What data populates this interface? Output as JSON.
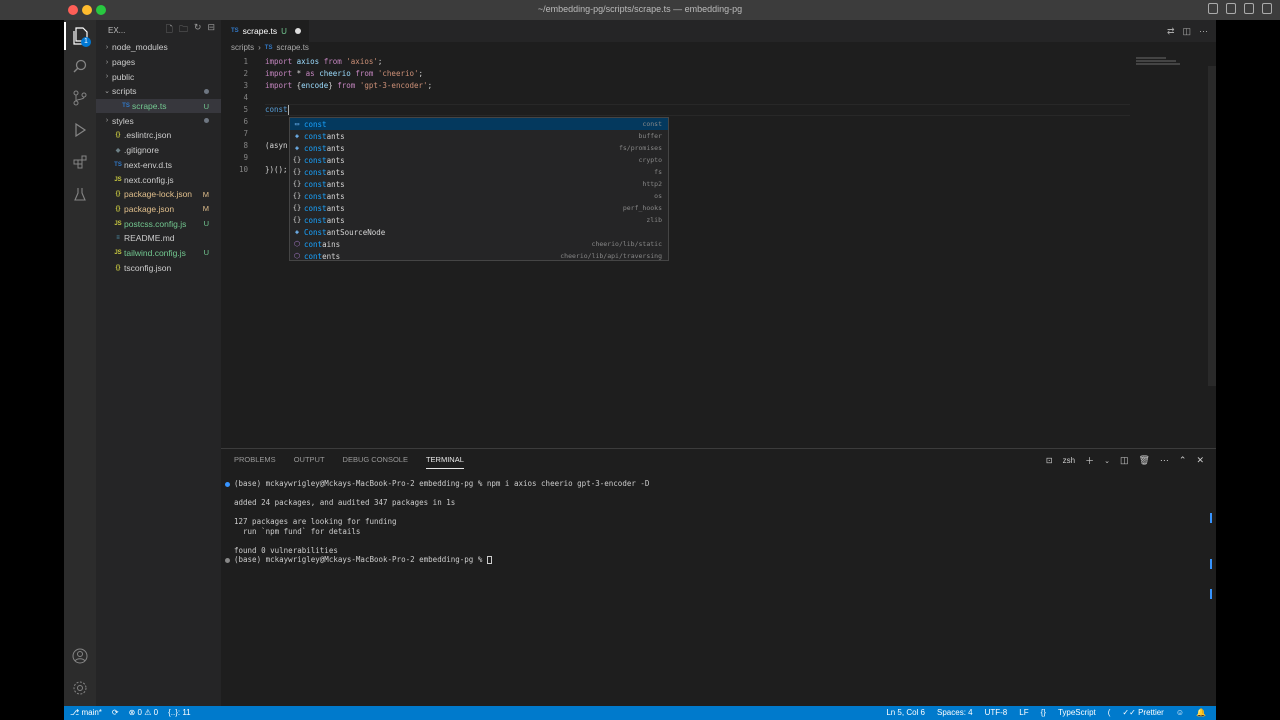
{
  "window": {
    "title": "~/embedding-pg/scripts/scrape.ts — embedding-pg"
  },
  "activity_bar": {
    "scm_badge": "1"
  },
  "sidebar": {
    "title": "EX...",
    "items": [
      {
        "label": "node_modules",
        "type": "folder",
        "status": ""
      },
      {
        "label": "pages",
        "type": "folder",
        "status": ""
      },
      {
        "label": "public",
        "type": "folder",
        "status": ""
      },
      {
        "label": "scripts",
        "type": "folder-open",
        "status": "dot"
      },
      {
        "label": "scrape.ts",
        "type": "ts",
        "status": "U"
      },
      {
        "label": "styles",
        "type": "folder",
        "status": "dot"
      },
      {
        "label": ".eslintrc.json",
        "type": "json",
        "status": ""
      },
      {
        "label": ".gitignore",
        "type": "cfg",
        "status": ""
      },
      {
        "label": "next-env.d.ts",
        "type": "ts",
        "status": ""
      },
      {
        "label": "next.config.js",
        "type": "js",
        "status": ""
      },
      {
        "label": "package-lock.json",
        "type": "json",
        "status": "M"
      },
      {
        "label": "package.json",
        "type": "json",
        "status": "M"
      },
      {
        "label": "postcss.config.js",
        "type": "js",
        "status": "U"
      },
      {
        "label": "README.md",
        "type": "md",
        "status": ""
      },
      {
        "label": "tailwind.config.js",
        "type": "js",
        "status": "U"
      },
      {
        "label": "tsconfig.json",
        "type": "json",
        "status": ""
      }
    ]
  },
  "editor": {
    "tab": {
      "icon": "TS",
      "label": "scrape.ts",
      "status": "U"
    },
    "breadcrumb": [
      "scripts",
      "scrape.ts"
    ],
    "lines": [
      {
        "n": "1",
        "tokens": [
          [
            "kw",
            "import "
          ],
          [
            "id",
            "axios "
          ],
          [
            "kw",
            "from "
          ],
          [
            "str",
            "'axios'"
          ],
          [
            "pl",
            ";"
          ]
        ]
      },
      {
        "n": "2",
        "tokens": [
          [
            "kw",
            "import "
          ],
          [
            "pl",
            "* "
          ],
          [
            "kw",
            "as "
          ],
          [
            "id",
            "cheerio "
          ],
          [
            "kw",
            "from "
          ],
          [
            "str",
            "'cheerio'"
          ],
          [
            "pl",
            ";"
          ]
        ]
      },
      {
        "n": "3",
        "tokens": [
          [
            "kw",
            "import "
          ],
          [
            "pl",
            "{"
          ],
          [
            "id",
            "encode"
          ],
          [
            "pl",
            "} "
          ],
          [
            "kw",
            "from "
          ],
          [
            "str",
            "'gpt-3-encoder'"
          ],
          [
            "pl",
            ";"
          ]
        ]
      },
      {
        "n": "4",
        "tokens": []
      },
      {
        "n": "5",
        "tokens": [
          [
            "bk",
            "const"
          ]
        ]
      },
      {
        "n": "6",
        "tokens": []
      },
      {
        "n": "7",
        "tokens": []
      },
      {
        "n": "8",
        "tokens": [
          [
            "pl",
            "(asyn"
          ]
        ]
      },
      {
        "n": "9",
        "tokens": []
      },
      {
        "n": "10",
        "tokens": [
          [
            "pl",
            "})();"
          ]
        ]
      }
    ]
  },
  "suggestions": [
    {
      "icon": "kw",
      "match": "const",
      "rest": "",
      "detail": "const",
      "selected": true
    },
    {
      "icon": "var",
      "match": "const",
      "rest": "ants",
      "detail": "buffer"
    },
    {
      "icon": "var",
      "match": "const",
      "rest": "ants",
      "detail": "fs/promises"
    },
    {
      "icon": "mod",
      "match": "const",
      "rest": "ants",
      "detail": "crypto"
    },
    {
      "icon": "mod",
      "match": "const",
      "rest": "ants",
      "detail": "fs"
    },
    {
      "icon": "mod",
      "match": "const",
      "rest": "ants",
      "detail": "http2"
    },
    {
      "icon": "mod",
      "match": "const",
      "rest": "ants",
      "detail": "os"
    },
    {
      "icon": "mod",
      "match": "const",
      "rest": "ants",
      "detail": "perf_hooks"
    },
    {
      "icon": "mod",
      "match": "const",
      "rest": "ants",
      "detail": "zlib"
    },
    {
      "icon": "var",
      "match": "Const",
      "rest": "antSourceNode",
      "detail": ""
    },
    {
      "icon": "mth",
      "match": "cont",
      "rest": "ains",
      "detail": "cheerio/lib/static"
    },
    {
      "icon": "mth",
      "match": "cont",
      "rest": "ents",
      "detail": "cheerio/lib/api/traversing"
    }
  ],
  "panel": {
    "tabs": [
      "PROBLEMS",
      "OUTPUT",
      "DEBUG CONSOLE",
      "TERMINAL"
    ],
    "active_tab": "TERMINAL",
    "shell": "zsh",
    "terminal": {
      "line1": "(base) mckaywrigley@Mckays-MacBook-Pro-2 embedding-pg % npm i axios cheerio gpt-3-encoder -D",
      "line2": "added 24 packages, and audited 347 packages in 1s",
      "line3": "127 packages are looking for funding",
      "line4": "  run `npm fund` for details",
      "line5": "found 0 vulnerabilities",
      "line6": "(base) mckaywrigley@Mckays-MacBook-Pro-2 embedding-pg % "
    }
  },
  "status_bar": {
    "branch": "main*",
    "errors": "0",
    "warnings": "0",
    "extra": "{..}: 11",
    "position": "Ln 5, Col 6",
    "spaces": "Spaces: 4",
    "encoding": "UTF-8",
    "eol": "LF",
    "language": "TypeScript",
    "formatter": "Prettier"
  }
}
